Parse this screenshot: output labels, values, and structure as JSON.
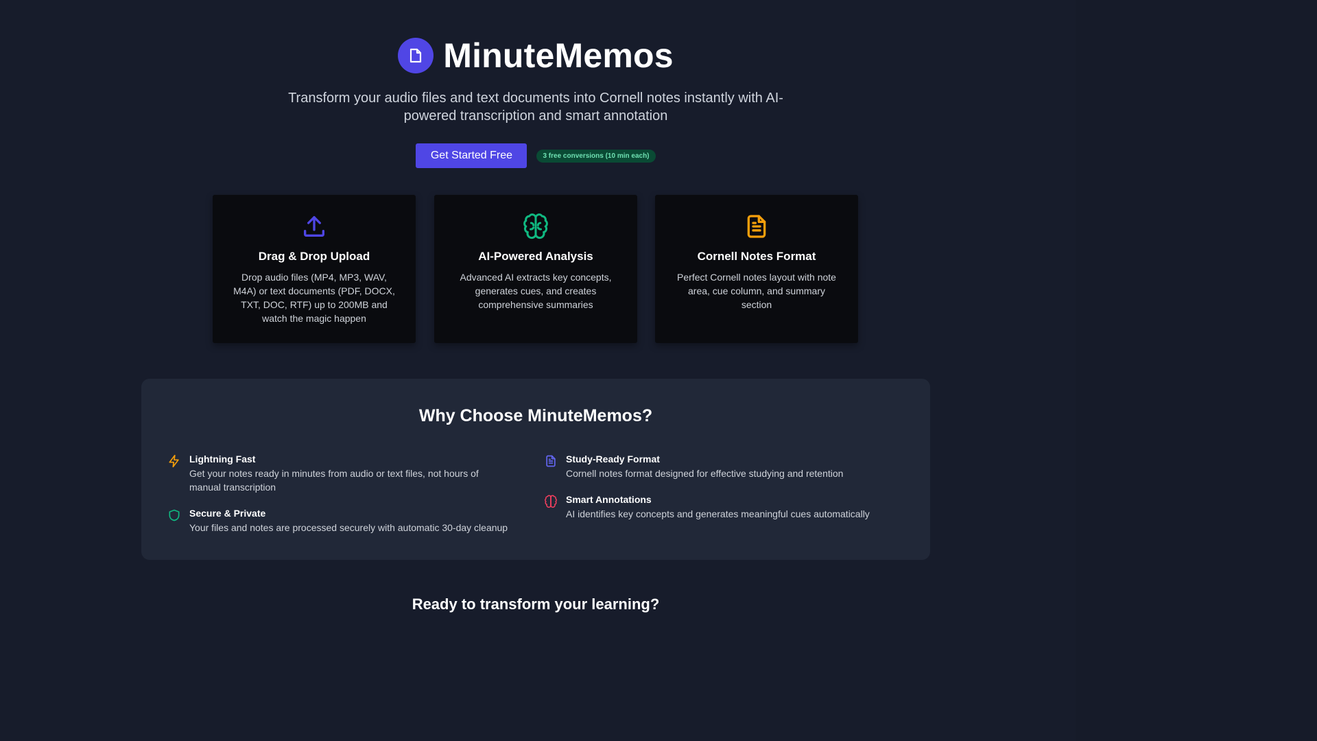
{
  "brand": {
    "name": "MinuteMemos",
    "logo_icon": "document-icon",
    "accent": "#4f46e5"
  },
  "hero": {
    "tagline": "Transform your audio files and text documents into Cornell notes instantly with AI-powered transcription and smart annotation",
    "cta_label": "Get Started Free",
    "free_badge": "3 free conversions (10 min each)"
  },
  "features": [
    {
      "icon": "upload-icon",
      "color": "#4f46e5",
      "title": "Drag & Drop Upload",
      "desc": "Drop audio files (MP4, MP3, WAV, M4A) or text documents (PDF, DOCX, TXT, DOC, RTF) up to 200MB and watch the magic happen"
    },
    {
      "icon": "brain-icon",
      "color": "#10b981",
      "title": "AI-Powered Analysis",
      "desc": "Advanced AI extracts key concepts, generates cues, and creates comprehensive summaries"
    },
    {
      "icon": "file-text-icon",
      "color": "#f59e0b",
      "title": "Cornell Notes Format",
      "desc": "Perfect Cornell notes layout with note area, cue column, and summary section"
    }
  ],
  "why": {
    "title": "Why Choose MinuteMemos?",
    "items": [
      {
        "icon": "lightning-icon",
        "color": "#f59e0b",
        "title": "Lightning Fast",
        "desc": "Get your notes ready in minutes from audio or text files, not hours of manual transcription"
      },
      {
        "icon": "shield-icon",
        "color": "#10b981",
        "title": "Secure & Private",
        "desc": "Your files and notes are processed securely with automatic 30-day cleanup"
      },
      {
        "icon": "file-text-icon",
        "color": "#6366f1",
        "title": "Study-Ready Format",
        "desc": "Cornell notes format designed for effective studying and retention"
      },
      {
        "icon": "brain-icon",
        "color": "#f43f5e",
        "title": "Smart Annotations",
        "desc": "AI identifies key concepts and generates meaningful cues automatically"
      }
    ]
  },
  "bottom": {
    "heading": "Ready to transform your learning?"
  }
}
